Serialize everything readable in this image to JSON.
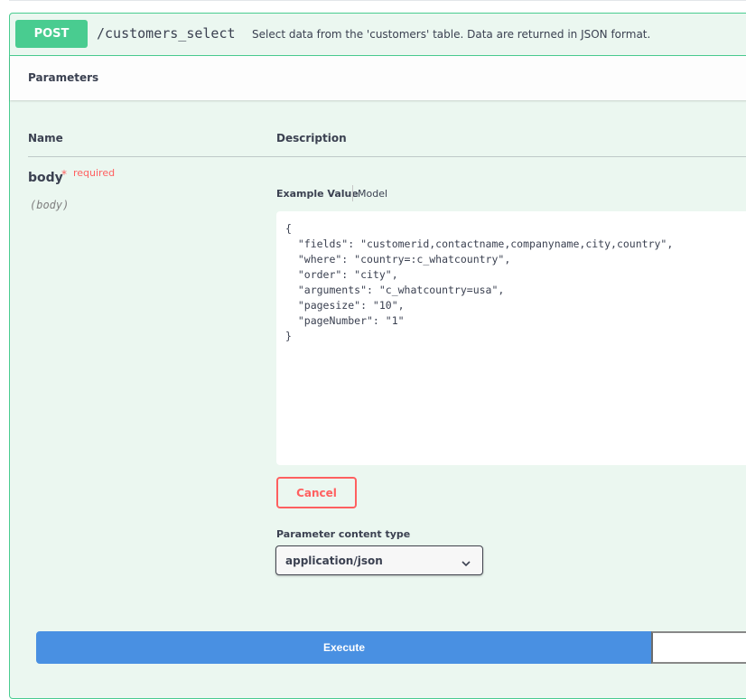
{
  "operation": {
    "method": "POST",
    "path": "/customers_select",
    "summary": "Select data from the 'customers' table. Data are returned in JSON format.",
    "color": "#49cc90"
  },
  "parameters": {
    "section_title": "Parameters",
    "columns": {
      "name": "Name",
      "description": "Description"
    },
    "param": {
      "name": "body",
      "required_star": "*",
      "required_label": "required",
      "in": "(body)"
    },
    "tabs": {
      "example": "Example Value",
      "model": "Model"
    },
    "example_value": "{\n  \"fields\": \"customerid,contactname,companyname,city,country\",\n  \"where\": \"country=:c_whatcountry\",\n  \"order\": \"city\",\n  \"arguments\": \"c_whatcountry=usa\",\n  \"pagesize\": \"10\",\n  \"pageNumber\": \"1\"\n}",
    "cancel_label": "Cancel",
    "content_type_label": "Parameter content type",
    "content_type_value": "application/json"
  },
  "execute": {
    "label": "Execute",
    "color": "#4990e2"
  },
  "icons": {
    "select_arrow": "chevron-down-icon"
  }
}
